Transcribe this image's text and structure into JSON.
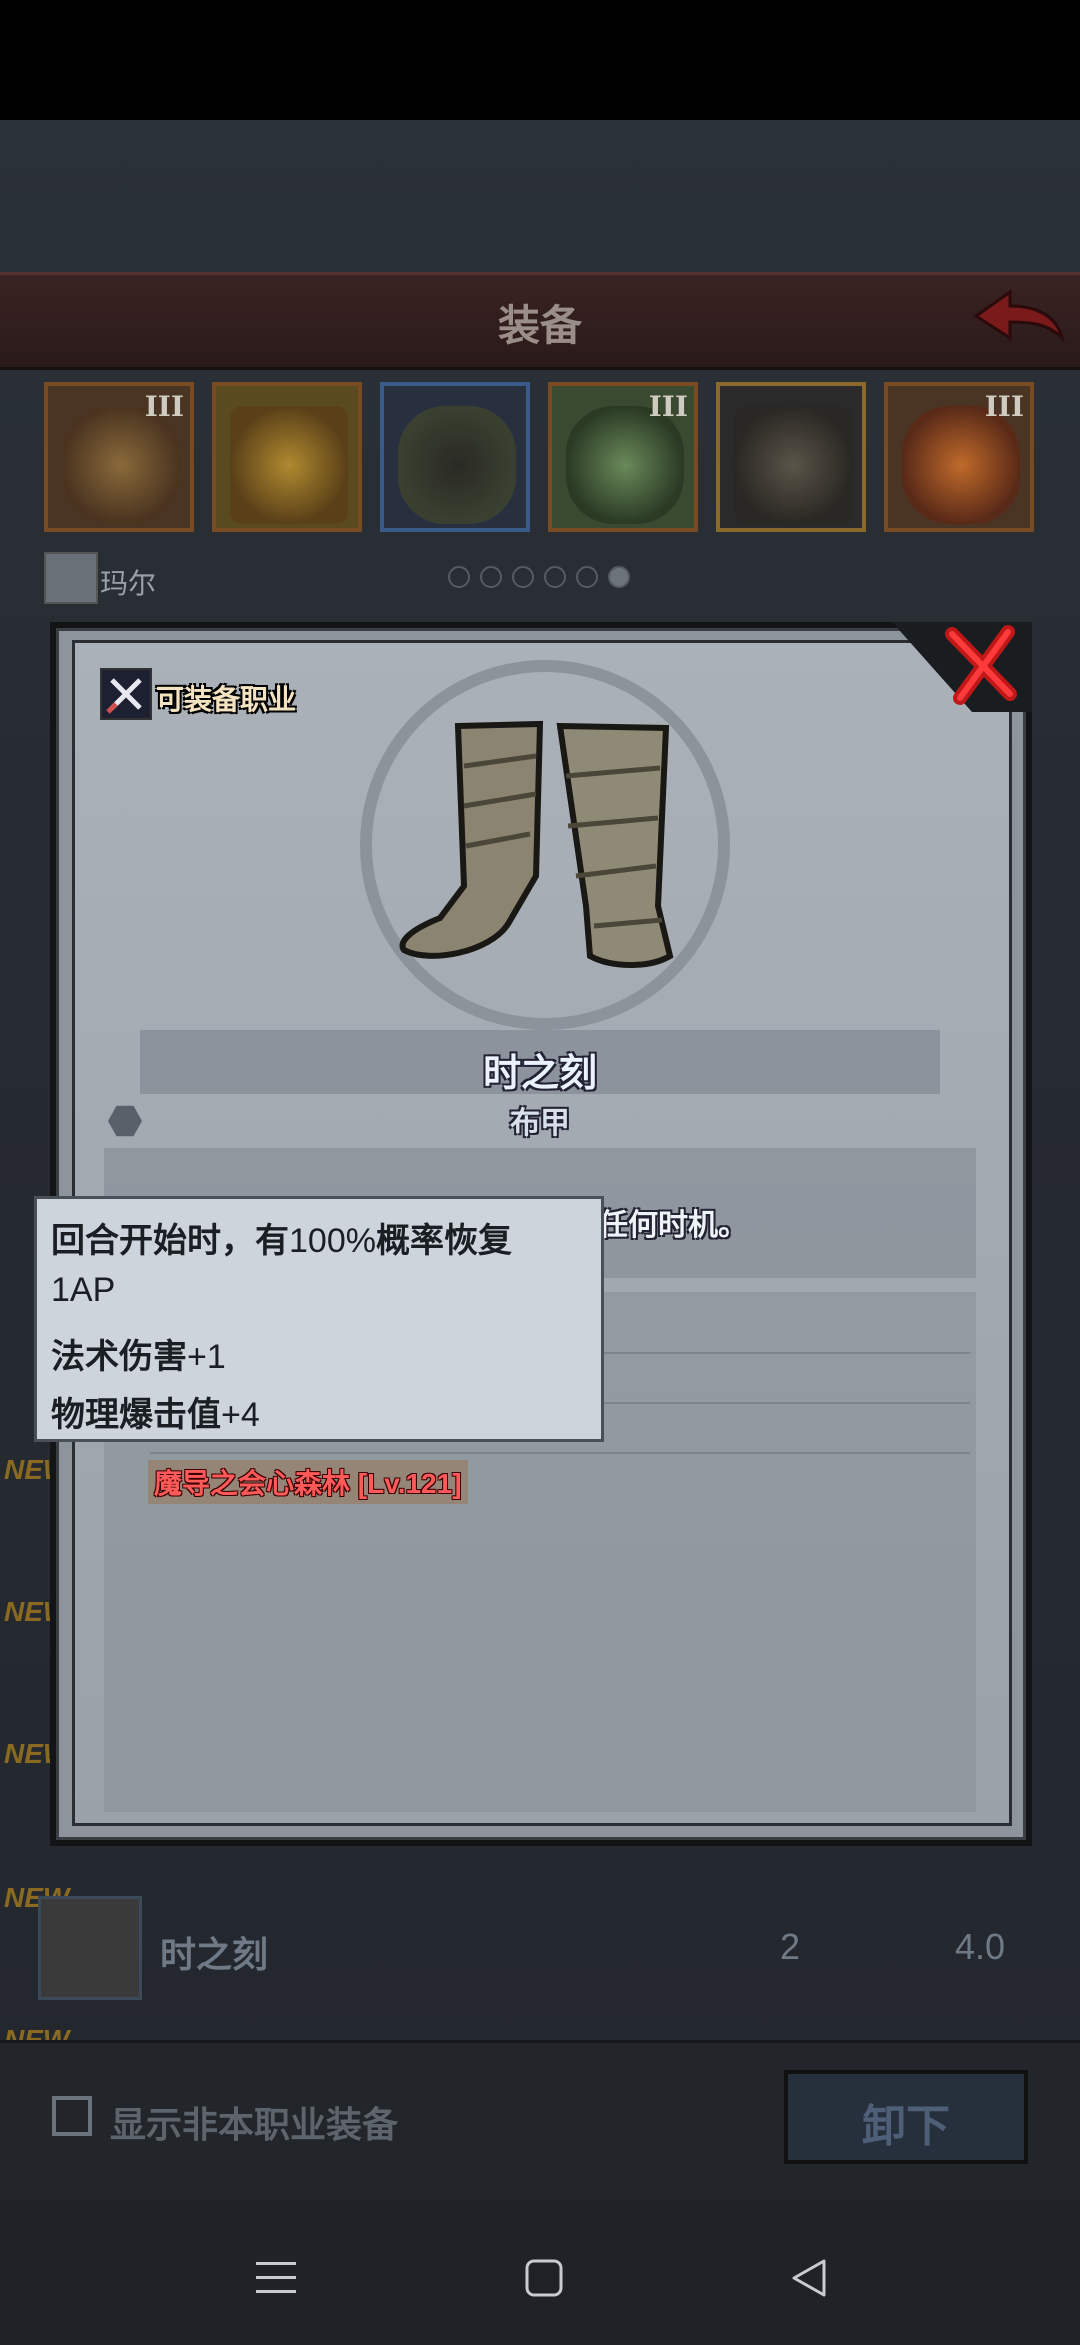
{
  "header": {
    "title": "装备"
  },
  "slots": [
    {
      "tier": "III"
    },
    {
      "tier": ""
    },
    {
      "tier": ""
    },
    {
      "tier": "III"
    },
    {
      "tier": ""
    },
    {
      "tier": "III"
    }
  ],
  "character": {
    "name": "玛尔"
  },
  "modal": {
    "class_badge_label": "可装备职业",
    "item_name": "时之刻",
    "item_type": "布甲",
    "description_tail": "任何时机。",
    "set_tag": "魔导之会心森林 [Lv.121]"
  },
  "tooltip": {
    "line1_bold": "回合开始时，有",
    "line1_rest": "100%",
    "line1_bold2": "概率恢复",
    "line2": "1AP",
    "line3_bold": "法术伤害",
    "line3_rest": "+1",
    "line4_bold": "物理爆击值",
    "line4_rest": "+4"
  },
  "list": {
    "new_tag": "NEW",
    "item_name": "时之刻",
    "item_level": "2",
    "item_score": "4.0"
  },
  "bottom": {
    "show_other_class_label": "显示非本职业装备",
    "unequip_label": "卸下"
  },
  "colors": {
    "set_tag_red": "#ff5a5a",
    "accent_red": "#c01818",
    "new_gold": "#8a6a20"
  }
}
